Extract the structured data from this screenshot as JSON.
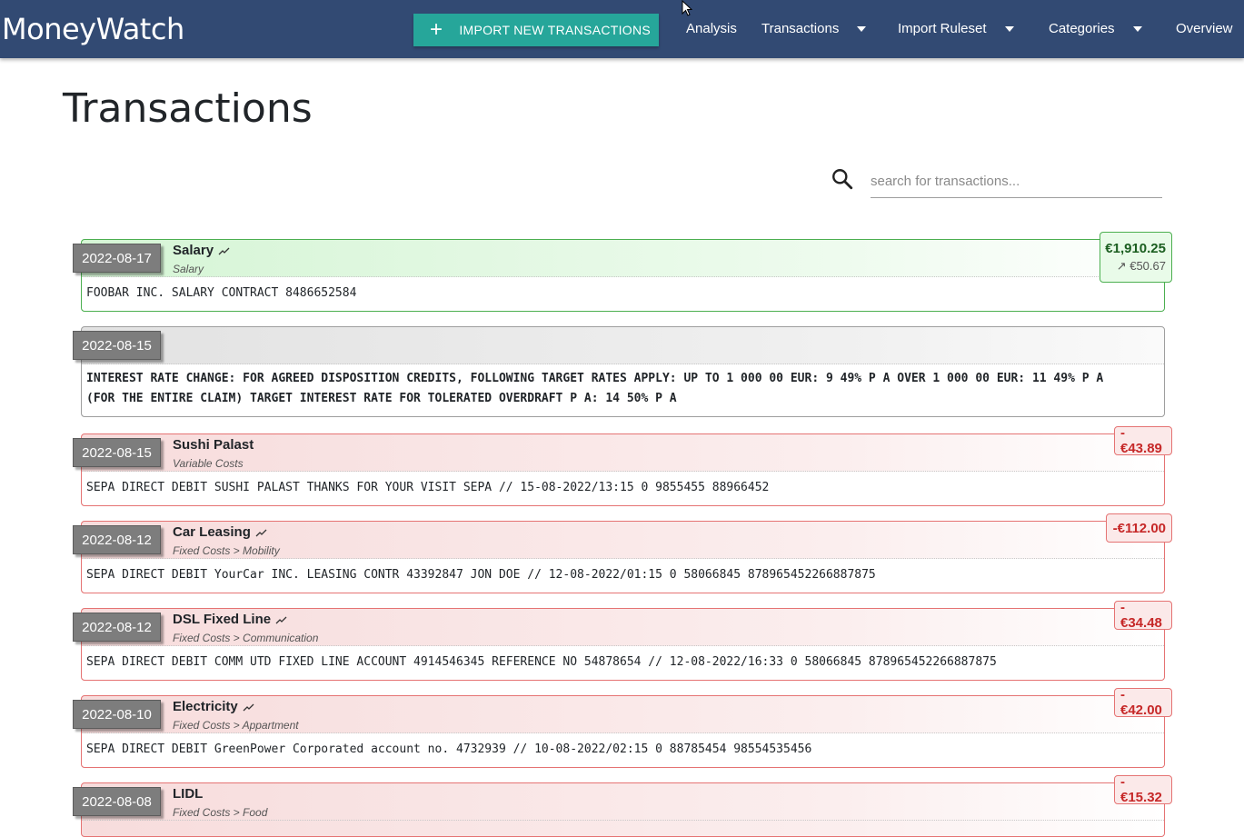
{
  "app": {
    "brand": "MoneyWatch",
    "import_button": "IMPORT NEW TRANSACTIONS",
    "nav": {
      "analysis": "Analysis",
      "transactions": "Transactions",
      "import_ruleset": "Import Ruleset",
      "categories": "Categories",
      "overview": "Overview"
    }
  },
  "page": {
    "title": "Transactions",
    "search_placeholder": "search for transactions..."
  },
  "transactions": [
    {
      "date": "2022-08-17",
      "name": "Salary",
      "category": "Salary",
      "amount": "€1,910.25",
      "sub_amount": "↗ €50.67",
      "description": "FOOBAR INC. SALARY CONTRACT 8486652584"
    },
    {
      "date": "2022-08-15",
      "name": "",
      "category": "",
      "amount": "",
      "description_line1": "INTEREST RATE CHANGE: FOR AGREED DISPOSITION CREDITS, FOLLOWING TARGET RATES APPLY: UP TO 1 000 00 EUR: 9 49% P A OVER 1 000 00 EUR: 11 49% P A",
      "description_line2": "(FOR THE ENTIRE CLAIM) TARGET INTEREST RATE FOR TOLERATED OVERDRAFT P A: 14 50% P A"
    },
    {
      "date": "2022-08-15",
      "name": "Sushi Palast",
      "category": "Variable Costs",
      "amount": "-€43.89",
      "description": "SEPA DIRECT DEBIT SUSHI PALAST THANKS FOR YOUR VISIT SEPA // 15-08-2022/13:15 0 9855455 88966452"
    },
    {
      "date": "2022-08-12",
      "name": "Car Leasing",
      "category": "Fixed Costs > Mobility",
      "amount": "-€112.00",
      "description": "SEPA DIRECT DEBIT YourCar INC. LEASING CONTR 43392847 JON DOE // 12-08-2022/01:15 0 58066845 878965452266887875"
    },
    {
      "date": "2022-08-12",
      "name": "DSL Fixed Line",
      "category": "Fixed Costs > Communication",
      "amount": "-€34.48",
      "description": "SEPA DIRECT DEBIT COMM UTD FIXED LINE ACCOUNT 4914546345 REFERENCE NO 54878654 // 12-08-2022/16:33 0 58066845 878965452266887875"
    },
    {
      "date": "2022-08-10",
      "name": "Electricity",
      "category": "Fixed Costs > Appartment",
      "amount": "-€42.00",
      "description": "SEPA DIRECT DEBIT GreenPower Corporated account no. 4732939 // 10-08-2022/02:15 0 88785454 98554535456"
    },
    {
      "date": "2022-08-08",
      "name": "LIDL",
      "category": "Fixed Costs > Food",
      "amount": "-€15.32",
      "description": ""
    }
  ]
}
